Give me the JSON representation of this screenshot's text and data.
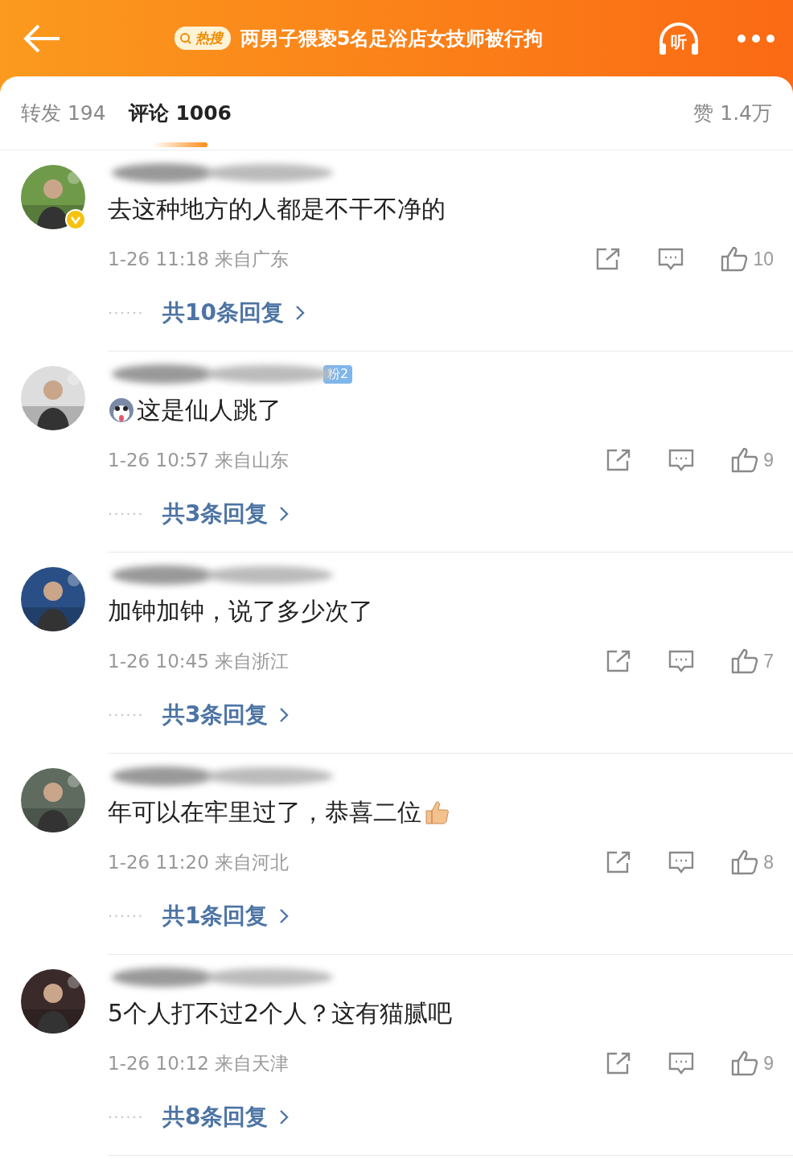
{
  "header": {
    "hot_badge": "热搜",
    "title": "两男子猥亵5名足浴店女技师被行拘",
    "listen": "听"
  },
  "tabs": [
    {
      "label": "转发",
      "count": "194",
      "selected": false
    },
    {
      "label": "评论",
      "count": "1006",
      "selected": true
    }
  ],
  "likes": {
    "label": "赞",
    "count": "1.4万"
  },
  "comments": [
    {
      "verified": true,
      "leading_icon": false,
      "trailing_icon": false,
      "text": "去这种地方的人都是不干不净的",
      "time": "1-26 11:18",
      "location": "来自广东",
      "likes": "10",
      "replies": "共10条回复"
    },
    {
      "verified": false,
      "badge": "粉2",
      "leading_icon": true,
      "trailing_icon": false,
      "text": "这是仙人跳了",
      "time": "1-26 10:57",
      "location": "来自山东",
      "likes": "9",
      "replies": "共3条回复"
    },
    {
      "verified": false,
      "leading_icon": false,
      "trailing_icon": false,
      "text": "加钟加钟，说了多少次了",
      "time": "1-26 10:45",
      "location": "来自浙江",
      "likes": "7",
      "replies": "共3条回复"
    },
    {
      "verified": false,
      "leading_icon": false,
      "trailing_icon": true,
      "text": "年可以在牢里过了，恭喜二位",
      "time": "1-26 11:20",
      "location": "来自河北",
      "likes": "8",
      "replies": "共1条回复"
    },
    {
      "verified": false,
      "leading_icon": false,
      "trailing_icon": false,
      "text": "5个人打不过2个人？这有猫腻吧",
      "time": "1-26 10:12",
      "location": "来自天津",
      "likes": "9",
      "replies": "共8条回复"
    }
  ]
}
